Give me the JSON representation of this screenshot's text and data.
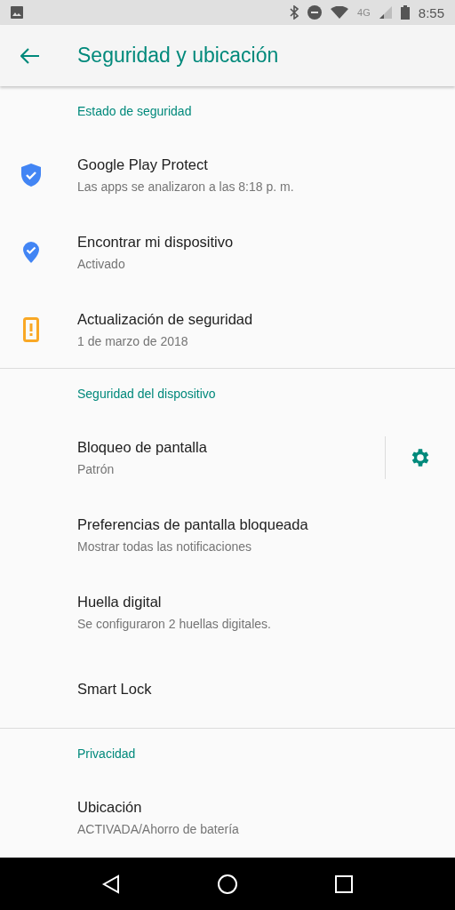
{
  "status_bar": {
    "network": "4G",
    "time": "8:55"
  },
  "app_bar": {
    "title": "Seguridad y ubicación"
  },
  "sections": [
    {
      "header": "Estado de seguridad",
      "items": [
        {
          "kind": "shield",
          "title": "Google Play Protect",
          "subtitle": "Las apps se analizaron a las 8:18 p. m.",
          "has_settings": false
        },
        {
          "kind": "pin",
          "title": "Encontrar mi dispositivo",
          "subtitle": "Activado",
          "has_settings": false
        },
        {
          "kind": "alert",
          "title": "Actualización de seguridad",
          "subtitle": "1 de marzo de 2018",
          "has_settings": false
        }
      ]
    },
    {
      "header": "Seguridad del dispositivo",
      "items": [
        {
          "kind": "plain",
          "title": "Bloqueo de pantalla",
          "subtitle": "Patrón",
          "has_settings": true
        },
        {
          "kind": "plain",
          "title": "Preferencias de pantalla bloqueada",
          "subtitle": "Mostrar todas las notificaciones",
          "has_settings": false
        },
        {
          "kind": "plain",
          "title": "Huella digital",
          "subtitle": "Se configuraron 2 huellas digitales.",
          "has_settings": false
        },
        {
          "kind": "plain",
          "title": "Smart Lock",
          "has_settings": false
        }
      ]
    },
    {
      "header": "Privacidad",
      "items": [
        {
          "kind": "plain",
          "title": "Ubicación",
          "subtitle": "ACTIVADA/Ahorro de batería",
          "has_settings": false
        }
      ]
    }
  ]
}
